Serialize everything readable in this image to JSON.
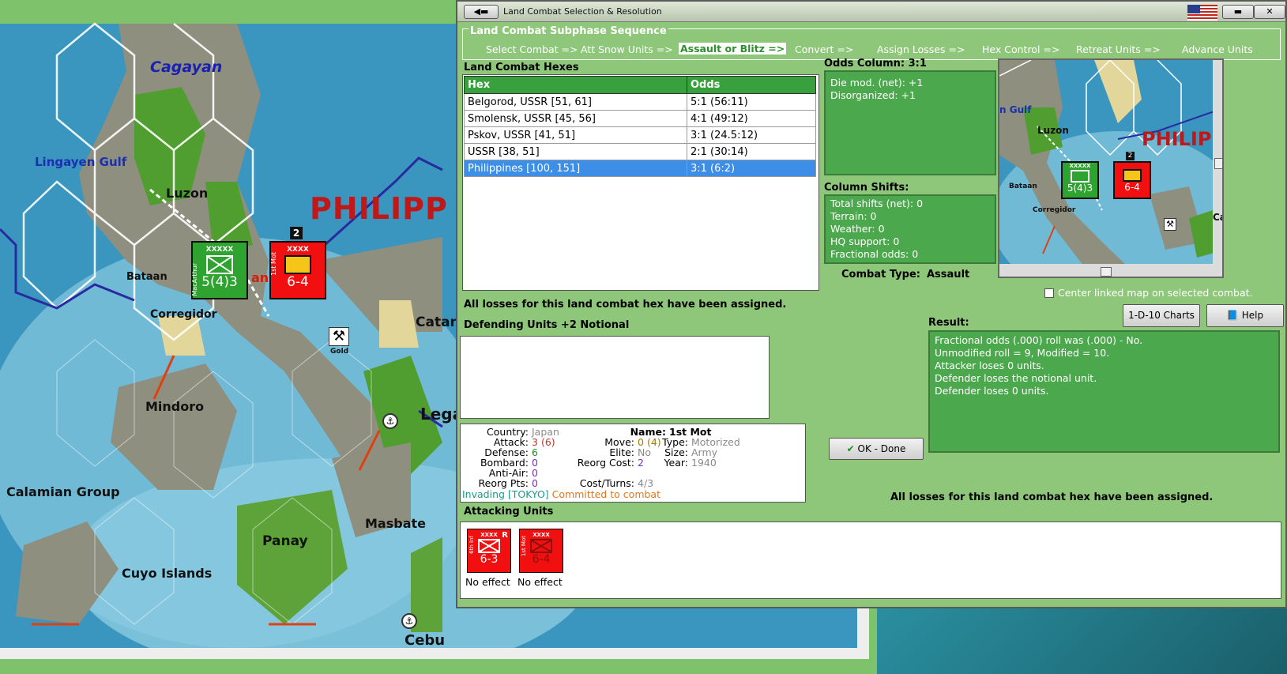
{
  "map": {
    "labels": {
      "cagayan": "Cagayan",
      "lingayen": "Lingayen Gulf",
      "luzon": "Luzon",
      "philippines": "PHILIPP",
      "bataan": "Bataan",
      "corregidor": "Corregidor",
      "mindoro": "Mindoro",
      "calamian": "Calamian Group",
      "cuyo": "Cuyo Islands",
      "panay": "Panay",
      "masbate": "Masbate",
      "catan": "Catan",
      "lega": "Lega",
      "cebu": "Cebu",
      "gold": "Gold",
      "manila_frag": "ani"
    },
    "units": [
      {
        "name": "MacArthur",
        "corps": "XXXXX",
        "strength": "5(4)3",
        "color": "#2fa32f"
      },
      {
        "name": "1st Mot",
        "corps": "XXXX",
        "strength": "6-4",
        "color": "#f20f0f",
        "badge": "2"
      }
    ]
  },
  "dialog": {
    "title": "Land Combat Selection & Resolution",
    "sequence": {
      "title": "Land Combat Subphase Sequence",
      "steps": [
        "Select Combat =>",
        "Att Snow Units =>",
        "Assault or Blitz =>",
        "Convert =>",
        "Assign Losses =>",
        "Hex Control =>",
        "Retreat Units =>",
        "Advance Units"
      ],
      "active_index": 2
    },
    "hexes": {
      "title": "Land Combat Hexes",
      "columns": [
        "Hex",
        "Odds"
      ],
      "rows": [
        [
          "Belgorod, USSR [51, 61]",
          "5:1 (56:11)"
        ],
        [
          "Smolensk, USSR [45, 56]",
          "4:1 (49:12)"
        ],
        [
          "Pskov, USSR [41, 51]",
          "3:1 (24.5:12)"
        ],
        [
          "USSR [38, 51]",
          "2:1 (30:14)"
        ],
        [
          "Philippines [100, 151]",
          "3:1 (6:2)"
        ]
      ],
      "selected_index": 4
    },
    "odds": {
      "title": "Odds Column: 3:1",
      "lines": [
        "Die mod. (net): +1",
        "Disorganized: +1"
      ]
    },
    "shifts": {
      "title": "Column Shifts:",
      "lines": [
        "Total shifts (net): 0",
        "Terrain: 0",
        "Weather: 0",
        "HQ support: 0",
        "Fractional odds: 0"
      ]
    },
    "combat_type": {
      "label": "Combat Type:",
      "value": "Assault"
    },
    "center_linked": "Center linked map on selected combat.",
    "losses_msg": "All losses for this land combat hex have been assigned.",
    "defending_title": "Defending Units +2 Notional",
    "charts_button": "1-D-10 Charts",
    "help_button": "Help",
    "result": {
      "title": "Result:",
      "lines": [
        "Fractional odds (.000) roll was (.000)  - No.",
        "Unmodified roll = 9, Modified = 10.",
        "Attacker loses 0 units.",
        "Defender loses the notional unit.",
        "Defender loses 0 units."
      ]
    },
    "unit_info": {
      "country_k": "Country:",
      "country": "Japan",
      "attack_k": "Attack:",
      "attack": "3",
      "attack2": "(6)",
      "defense_k": "Defense:",
      "defense": "6",
      "bombard_k": "Bombard:",
      "bombard": "0",
      "antiair_k": "Anti-Air:",
      "antiair": "0",
      "reorgpts_k": "Reorg Pts:",
      "reorgpts": "0",
      "move_k": "Move:",
      "move": "0",
      "move2": "(4)",
      "elite_k": "Elite:",
      "elite": "No",
      "reorgcost_k": "Reorg Cost:",
      "reorgcost": "2",
      "costturns_k": "Cost/Turns:",
      "costturns": "4/3",
      "name_k": "Name:",
      "name": "1st Mot",
      "type_k": "Type:",
      "type": "Motorized",
      "size_k": "Size:",
      "size": "Army",
      "year_k": "Year:",
      "year": "1940",
      "invading": "Invading [TOKYO]",
      "committed": "Committed to combat"
    },
    "ok_button": "OK - Done",
    "losses_msg2": "All losses for this land combat hex have been assigned.",
    "attacking": {
      "title": "Attacking Units",
      "units": [
        {
          "name": "6th Inf",
          "corps": "XXXX",
          "strength": "6-3",
          "status": "No effect",
          "flag": "R"
        },
        {
          "name": "1st Mot",
          "corps": "XXXX",
          "strength": "6-4",
          "status": "No effect"
        }
      ]
    },
    "mini": {
      "gulf": "n Gulf",
      "luzon": "Luzon",
      "phil": "PHILIP",
      "bataan": "Bataan",
      "corregidor": "Corregidor",
      "ca": "Ca",
      "u1": "5(4)3",
      "u1c": "XXXXX",
      "u2": "6-4",
      "badge": "2"
    }
  }
}
